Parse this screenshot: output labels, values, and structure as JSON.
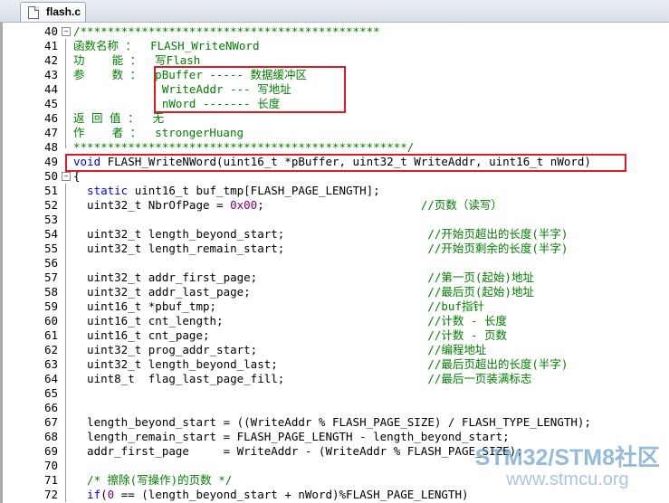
{
  "tab": {
    "filename": "flash.c"
  },
  "colors": {
    "keyword": "#0000ff",
    "comment": "#008000",
    "number": "#800080",
    "highlight": "#e01b24"
  },
  "lines": [
    {
      "n": "40",
      "fold": "minus",
      "parts": [
        [
          "cm",
          "/********************************************"
        ]
      ]
    },
    {
      "n": "41",
      "parts": [
        [
          "cm",
          "函数名称 ：  FLASH_WriteNWord"
        ]
      ]
    },
    {
      "n": "42",
      "parts": [
        [
          "cm",
          "功    能 ：  写Flash"
        ]
      ]
    },
    {
      "n": "43",
      "parts": [
        [
          "cm",
          "参    数 ：  pBuffer ----- 数据缓冲区"
        ]
      ]
    },
    {
      "n": "44",
      "parts": [
        [
          "cm",
          "             WriteAddr --- 写地址"
        ]
      ]
    },
    {
      "n": "45",
      "parts": [
        [
          "cm",
          "             nWord ------- 长度"
        ]
      ]
    },
    {
      "n": "46",
      "parts": [
        [
          "cm",
          "返 回 值 ：  无"
        ]
      ]
    },
    {
      "n": "47",
      "parts": [
        [
          "cm",
          "作    者 ：  strongerHuang"
        ]
      ]
    },
    {
      "n": "48",
      "fold": "end",
      "parts": [
        [
          "cm",
          "*************************************************/"
        ]
      ]
    },
    {
      "n": "49",
      "parts": [
        [
          "kw",
          "void"
        ],
        [
          "",
          " FLASH_WriteNWord(uint16_t *pBuffer, uint32_t WriteAddr, uint16_t nWord)"
        ]
      ]
    },
    {
      "n": "50",
      "fold": "minus",
      "parts": [
        [
          "",
          "{"
        ]
      ]
    },
    {
      "n": "51",
      "parts": [
        [
          "kw",
          "  static"
        ],
        [
          "",
          " uint16_t buf_tmp[FLASH_PAGE_LENGTH];"
        ]
      ]
    },
    {
      "n": "52",
      "parts": [
        [
          "",
          "  uint32_t NbrOfPage = "
        ],
        [
          "num",
          "0x00"
        ],
        [
          "",
          ";                       "
        ],
        [
          "cm",
          "//页数（读写）"
        ]
      ]
    },
    {
      "n": "53",
      "parts": []
    },
    {
      "n": "54",
      "parts": [
        [
          "",
          "  uint32_t length_beyond_start;                     "
        ],
        [
          "cm",
          "//开始页超出的长度(半字)"
        ]
      ]
    },
    {
      "n": "55",
      "parts": [
        [
          "",
          "  uint32_t length_remain_start;                     "
        ],
        [
          "cm",
          "//开始页剩余的长度(半字)"
        ]
      ]
    },
    {
      "n": "56",
      "parts": []
    },
    {
      "n": "57",
      "parts": [
        [
          "",
          "  uint32_t addr_first_page;                         "
        ],
        [
          "cm",
          "//第一页(起始)地址"
        ]
      ]
    },
    {
      "n": "58",
      "parts": [
        [
          "",
          "  uint32_t addr_last_page;                          "
        ],
        [
          "cm",
          "//最后页(起始)地址"
        ]
      ]
    },
    {
      "n": "59",
      "parts": [
        [
          "",
          "  uint16_t *pbuf_tmp;                               "
        ],
        [
          "cm",
          "//buf指针"
        ]
      ]
    },
    {
      "n": "60",
      "parts": [
        [
          "",
          "  uint16_t cnt_length;                              "
        ],
        [
          "cm",
          "//计数 - 长度"
        ]
      ]
    },
    {
      "n": "61",
      "parts": [
        [
          "",
          "  uint16_t cnt_page;                                "
        ],
        [
          "cm",
          "//计数 - 页数"
        ]
      ]
    },
    {
      "n": "62",
      "parts": [
        [
          "",
          "  uint32_t prog_addr_start;                         "
        ],
        [
          "cm",
          "//编程地址"
        ]
      ]
    },
    {
      "n": "63",
      "parts": [
        [
          "",
          "  uint32_t length_beyond_last;                      "
        ],
        [
          "cm",
          "//最后页超出的长度(半字)"
        ]
      ]
    },
    {
      "n": "64",
      "parts": [
        [
          "",
          "  uint8_t  flag_last_page_fill;                     "
        ],
        [
          "cm",
          "//最后一页装满标志"
        ]
      ]
    },
    {
      "n": "65",
      "parts": []
    },
    {
      "n": "66",
      "parts": []
    },
    {
      "n": "67",
      "parts": [
        [
          "",
          "  length_beyond_start = ((WriteAddr % FLASH_PAGE_SIZE) / FLASH_TYPE_LENGTH);"
        ]
      ]
    },
    {
      "n": "68",
      "parts": [
        [
          "",
          "  length_remain_start = FLASH_PAGE_LENGTH - length_beyond_start;"
        ]
      ]
    },
    {
      "n": "69",
      "parts": [
        [
          "",
          "  addr_first_page     = WriteAddr - (WriteAddr % FLASH_PAGE_SIZE);"
        ]
      ]
    },
    {
      "n": "70",
      "parts": []
    },
    {
      "n": "71",
      "parts": [
        [
          "cm",
          "  /* 擦除(写操作)的页数 */"
        ]
      ]
    },
    {
      "n": "72",
      "parts": [
        [
          "kw",
          "  if"
        ],
        [
          "",
          "("
        ],
        [
          "num",
          "0"
        ],
        [
          "",
          " == (length_beyond_start + nWord)%FLASH_PAGE_LENGTH)"
        ]
      ]
    }
  ],
  "watermark": {
    "line1": "STM32/STM8社区",
    "line2": "www.stmcu.org"
  }
}
